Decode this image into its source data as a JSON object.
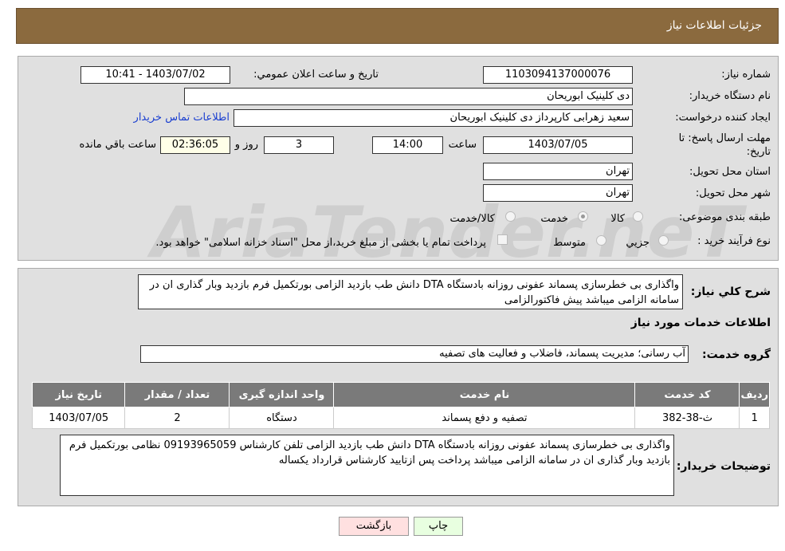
{
  "header": {
    "title": "جزئیات اطلاعات نیاز"
  },
  "fields": {
    "need_number_label": "شماره نیاز:",
    "need_number": "1103094137000076",
    "announce_label": "تاریخ و ساعت اعلان عمومي:",
    "announce": "1403/07/02 - 10:41",
    "buyer_label": "نام دستگاه خریدار:",
    "buyer": "دی کلینیک ابوریحان",
    "creator_label": "ایجاد کننده درخواست:",
    "creator": "سعید زهرابی کارپرداز دی کلینیک ابوریحان",
    "contact_link": "اطلاعات تماس خریدار",
    "deadline_label": "مهلت ارسال پاسخ: تا تاریخ:",
    "deadline_date": "1403/07/05",
    "time_label": "ساعت",
    "deadline_time": "14:00",
    "days": "3",
    "days_label": "روز و",
    "remaining": "02:36:05",
    "remaining_label": "ساعت باقي مانده",
    "province_label": "استان محل تحویل:",
    "province": "تهران",
    "city_label": "شهر محل تحویل:",
    "city": "تهران",
    "category_label": "طبقه بندی موضوعی:",
    "category_options": [
      "کالا",
      "خدمت",
      "کالا/خدمت"
    ],
    "category_selected": "خدمت",
    "process_label": "نوع فرآیند خرید :",
    "process_options": [
      "جزيي",
      "متوسط"
    ],
    "payment_note": "پرداخت تمام یا بخشی از مبلغ خرید،از محل \"اسناد خزانه اسلامی\" خواهد بود."
  },
  "description": {
    "label": "شرح کلي نیاز:",
    "text": "واگذاری بی خطرسازی پسماند عفونی روزانه بادستگاه DTA دانش طب بازدید الزامی بورتکمیل فرم بازدید وبار گذاری ان در سامانه الزامی میباشد پیش فاکتورالزامی"
  },
  "services": {
    "title": "اطلاعات خدمات مورد نیاز",
    "group_label": "گروه خدمت:",
    "group": "آب رسانی؛ مدیریت پسماند، فاضلاب و فعالیت های تصفیه",
    "columns": [
      "ردیف",
      "کد خدمت",
      "نام خدمت",
      "واحد اندازه گیری",
      "تعداد / مقدار",
      "تاریخ نیاز"
    ],
    "rows": [
      [
        "1",
        "ث-38-382",
        "تصفیه و دفع پسماند",
        "دستگاه",
        "2",
        "1403/07/05"
      ]
    ]
  },
  "buyer_notes": {
    "label": "توضیحات خریدار:",
    "text": "واگذاری بی خطرسازی پسماند عفونی روزانه بادستگاه DTA دانش طب بازدید الزامی تلفن کارشناس 09193965059 نظامی بورتکمیل فرم بازدید وبار گذاری ان در سامانه الزامی میباشد پرداخت پس ازتایید کارشناس قرارداد یکساله"
  },
  "buttons": {
    "print": "چاپ",
    "back": "بازگشت"
  },
  "watermark": "AriaTender.neT"
}
